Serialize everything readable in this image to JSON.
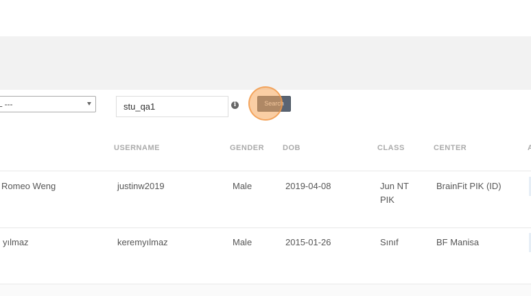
{
  "filters": {
    "level_select_value": "L ---",
    "search_value": "stu_qa1",
    "search_button_label": "Search"
  },
  "table": {
    "columns": [
      "USERNAME",
      "GENDER",
      "DOB",
      "CLASS",
      "CENTER",
      "A"
    ],
    "rows": [
      {
        "name": "Romeo Weng",
        "username": "justinw2019",
        "gender": "Male",
        "dob": "2019-04-08",
        "class_line1": "Jun NT",
        "class_line2": "PIK",
        "center": "BrainFit PIK (ID)"
      },
      {
        "name": "yılmaz",
        "username": "keremyılmaz",
        "gender": "Male",
        "dob": "2015-01-26",
        "class_line1": "Sınıf",
        "class_line2": "",
        "center": "BF Manisa"
      }
    ]
  },
  "colors": {
    "search_button": "#5a6473",
    "click_indicator": "#f5a55a",
    "header_text": "#aaaaaa",
    "band": "#f2f2f2"
  }
}
